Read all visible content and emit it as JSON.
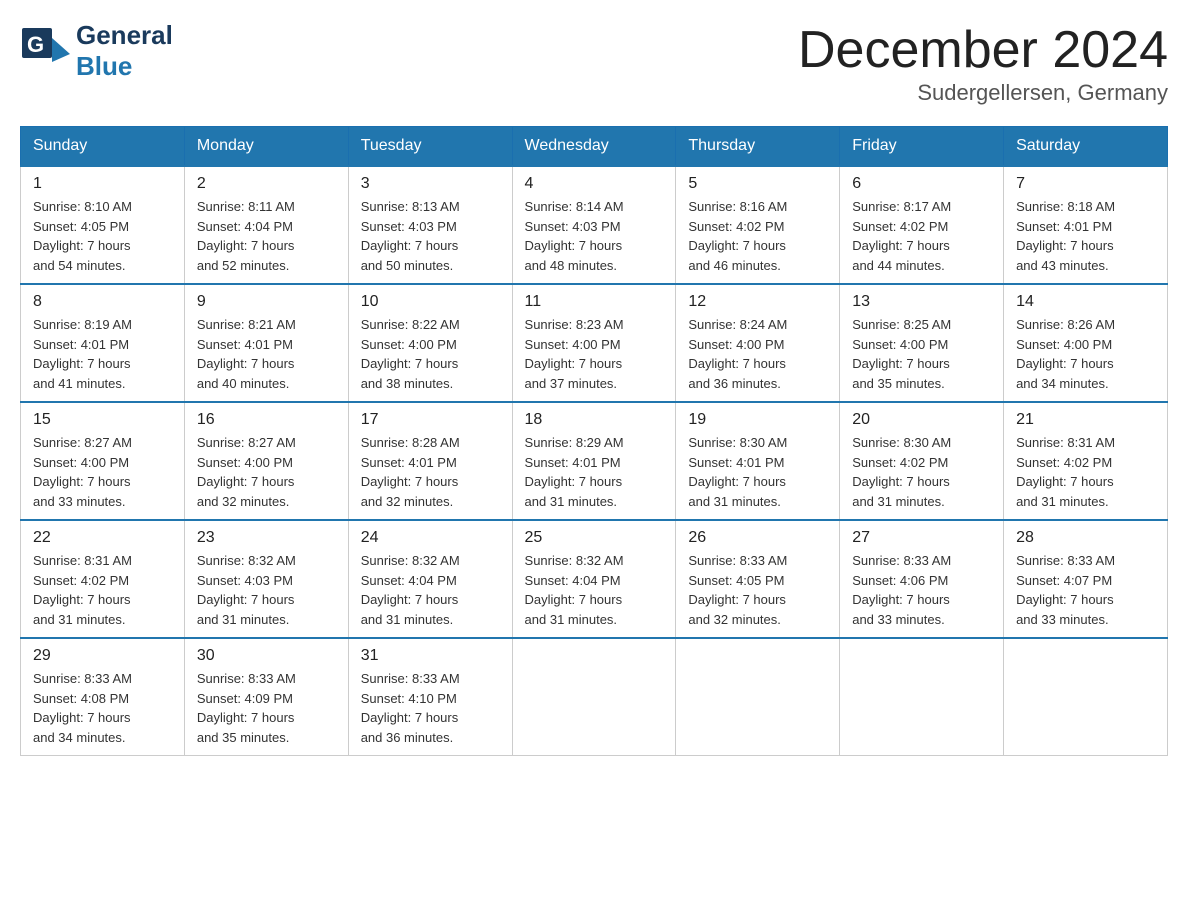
{
  "header": {
    "logo_general": "General",
    "logo_blue": "Blue",
    "month_title": "December 2024",
    "subtitle": "Sudergellersen, Germany"
  },
  "weekdays": [
    "Sunday",
    "Monday",
    "Tuesday",
    "Wednesday",
    "Thursday",
    "Friday",
    "Saturday"
  ],
  "weeks": [
    [
      {
        "day": "1",
        "sunrise": "8:10 AM",
        "sunset": "4:05 PM",
        "daylight": "7 hours and 54 minutes."
      },
      {
        "day": "2",
        "sunrise": "8:11 AM",
        "sunset": "4:04 PM",
        "daylight": "7 hours and 52 minutes."
      },
      {
        "day": "3",
        "sunrise": "8:13 AM",
        "sunset": "4:03 PM",
        "daylight": "7 hours and 50 minutes."
      },
      {
        "day": "4",
        "sunrise": "8:14 AM",
        "sunset": "4:03 PM",
        "daylight": "7 hours and 48 minutes."
      },
      {
        "day": "5",
        "sunrise": "8:16 AM",
        "sunset": "4:02 PM",
        "daylight": "7 hours and 46 minutes."
      },
      {
        "day": "6",
        "sunrise": "8:17 AM",
        "sunset": "4:02 PM",
        "daylight": "7 hours and 44 minutes."
      },
      {
        "day": "7",
        "sunrise": "8:18 AM",
        "sunset": "4:01 PM",
        "daylight": "7 hours and 43 minutes."
      }
    ],
    [
      {
        "day": "8",
        "sunrise": "8:19 AM",
        "sunset": "4:01 PM",
        "daylight": "7 hours and 41 minutes."
      },
      {
        "day": "9",
        "sunrise": "8:21 AM",
        "sunset": "4:01 PM",
        "daylight": "7 hours and 40 minutes."
      },
      {
        "day": "10",
        "sunrise": "8:22 AM",
        "sunset": "4:00 PM",
        "daylight": "7 hours and 38 minutes."
      },
      {
        "day": "11",
        "sunrise": "8:23 AM",
        "sunset": "4:00 PM",
        "daylight": "7 hours and 37 minutes."
      },
      {
        "day": "12",
        "sunrise": "8:24 AM",
        "sunset": "4:00 PM",
        "daylight": "7 hours and 36 minutes."
      },
      {
        "day": "13",
        "sunrise": "8:25 AM",
        "sunset": "4:00 PM",
        "daylight": "7 hours and 35 minutes."
      },
      {
        "day": "14",
        "sunrise": "8:26 AM",
        "sunset": "4:00 PM",
        "daylight": "7 hours and 34 minutes."
      }
    ],
    [
      {
        "day": "15",
        "sunrise": "8:27 AM",
        "sunset": "4:00 PM",
        "daylight": "7 hours and 33 minutes."
      },
      {
        "day": "16",
        "sunrise": "8:27 AM",
        "sunset": "4:00 PM",
        "daylight": "7 hours and 32 minutes."
      },
      {
        "day": "17",
        "sunrise": "8:28 AM",
        "sunset": "4:01 PM",
        "daylight": "7 hours and 32 minutes."
      },
      {
        "day": "18",
        "sunrise": "8:29 AM",
        "sunset": "4:01 PM",
        "daylight": "7 hours and 31 minutes."
      },
      {
        "day": "19",
        "sunrise": "8:30 AM",
        "sunset": "4:01 PM",
        "daylight": "7 hours and 31 minutes."
      },
      {
        "day": "20",
        "sunrise": "8:30 AM",
        "sunset": "4:02 PM",
        "daylight": "7 hours and 31 minutes."
      },
      {
        "day": "21",
        "sunrise": "8:31 AM",
        "sunset": "4:02 PM",
        "daylight": "7 hours and 31 minutes."
      }
    ],
    [
      {
        "day": "22",
        "sunrise": "8:31 AM",
        "sunset": "4:02 PM",
        "daylight": "7 hours and 31 minutes."
      },
      {
        "day": "23",
        "sunrise": "8:32 AM",
        "sunset": "4:03 PM",
        "daylight": "7 hours and 31 minutes."
      },
      {
        "day": "24",
        "sunrise": "8:32 AM",
        "sunset": "4:04 PM",
        "daylight": "7 hours and 31 minutes."
      },
      {
        "day": "25",
        "sunrise": "8:32 AM",
        "sunset": "4:04 PM",
        "daylight": "7 hours and 31 minutes."
      },
      {
        "day": "26",
        "sunrise": "8:33 AM",
        "sunset": "4:05 PM",
        "daylight": "7 hours and 32 minutes."
      },
      {
        "day": "27",
        "sunrise": "8:33 AM",
        "sunset": "4:06 PM",
        "daylight": "7 hours and 33 minutes."
      },
      {
        "day": "28",
        "sunrise": "8:33 AM",
        "sunset": "4:07 PM",
        "daylight": "7 hours and 33 minutes."
      }
    ],
    [
      {
        "day": "29",
        "sunrise": "8:33 AM",
        "sunset": "4:08 PM",
        "daylight": "7 hours and 34 minutes."
      },
      {
        "day": "30",
        "sunrise": "8:33 AM",
        "sunset": "4:09 PM",
        "daylight": "7 hours and 35 minutes."
      },
      {
        "day": "31",
        "sunrise": "8:33 AM",
        "sunset": "4:10 PM",
        "daylight": "7 hours and 36 minutes."
      },
      null,
      null,
      null,
      null
    ]
  ]
}
